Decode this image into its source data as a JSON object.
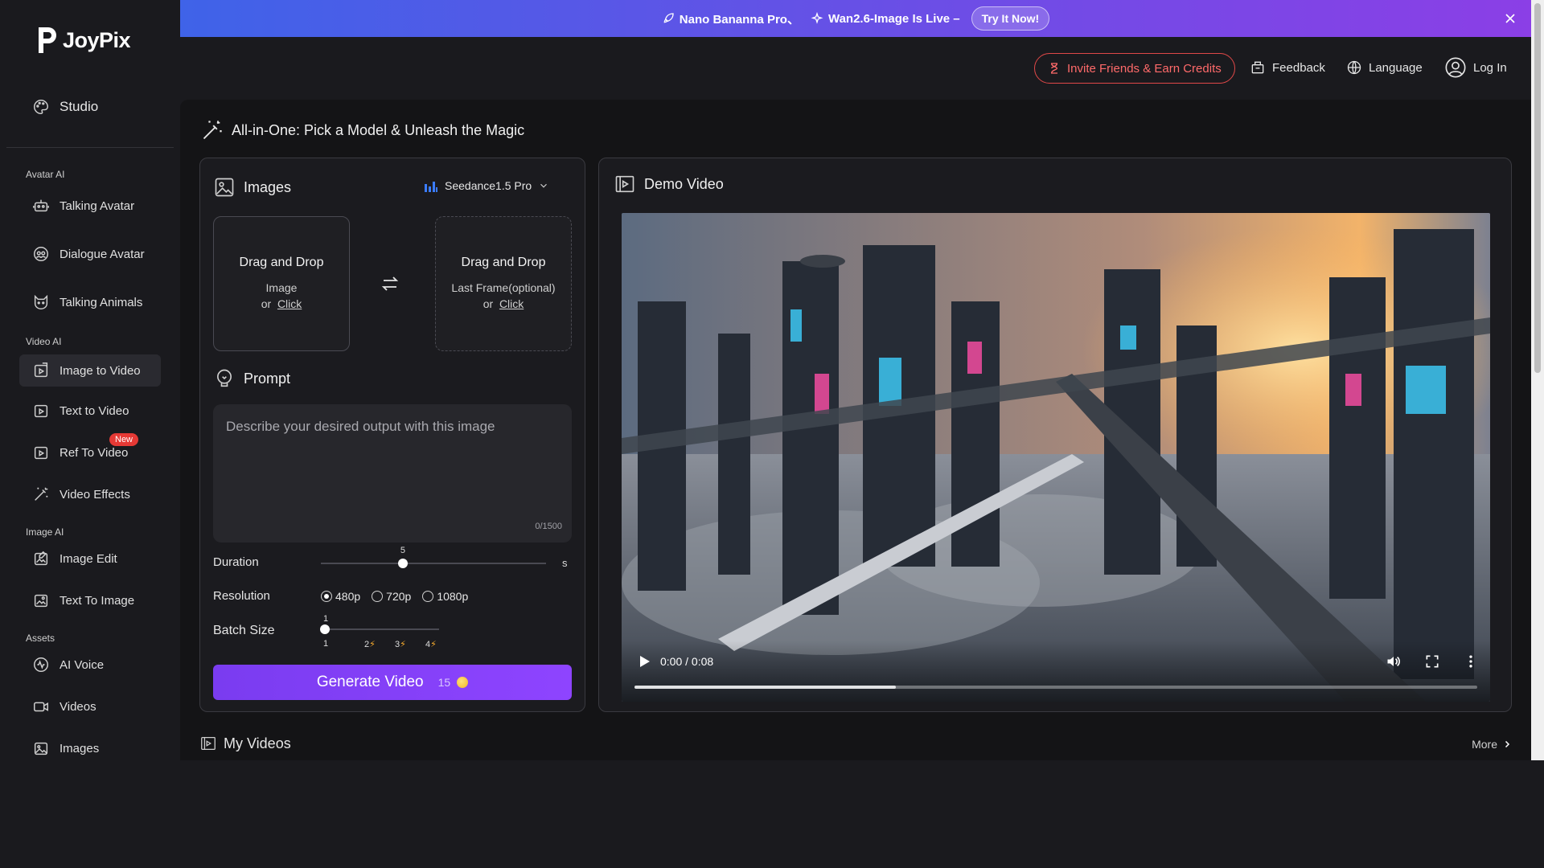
{
  "brand": {
    "name": "JoyPix"
  },
  "sidebar": {
    "studio": "Studio",
    "sections": {
      "avatar_ai": "Avatar AI",
      "video_ai": "Video AI",
      "image_ai": "Image AI",
      "assets": "Assets"
    },
    "items": {
      "talking_avatar": "Talking Avatar",
      "dialogue_avatar": "Dialogue Avatar",
      "talking_animals": "Talking Animals",
      "image_to_video": "Image to Video",
      "text_to_video": "Text to Video",
      "ref_to_video": "Ref To Video",
      "ref_badge": "New",
      "video_effects": "Video Effects",
      "image_edit": "Image Edit",
      "text_to_image": "Text To Image",
      "ai_voice": "AI Voice",
      "videos": "Videos",
      "images": "Images"
    },
    "active": "image_to_video"
  },
  "banner": {
    "item1": "Nano Bananna Pro、",
    "item2": "Wan2.6-Image Is Live –",
    "cta": "Try It Now!"
  },
  "topbar": {
    "invite": "Invite Friends & Earn Credits",
    "feedback": "Feedback",
    "language": "Language",
    "login": "Log In"
  },
  "main": {
    "title": "All-in-One: Pick a Model & Unleash the Magic",
    "images_label": "Images",
    "model": "Seedance1.5 Pro",
    "drop1": {
      "title": "Drag and Drop",
      "sub": "Image",
      "or": "or",
      "click": "Click"
    },
    "drop2": {
      "title": "Drag and Drop",
      "sub": "Last Frame(optional)",
      "or": "or",
      "click": "Click"
    },
    "prompt_label": "Prompt",
    "prompt_placeholder": "Describe your desired output with this image",
    "prompt_value": "",
    "counter": "0/1500",
    "duration": {
      "label": "Duration",
      "value": 5,
      "min": 1,
      "max": 12,
      "unit": "s",
      "value_text": "5"
    },
    "resolution": {
      "label": "Resolution",
      "options": [
        "480p",
        "720p",
        "1080p"
      ],
      "selected": "480p"
    },
    "batch": {
      "label": "Batch Size",
      "value_text": "1",
      "marks": [
        "1",
        "2",
        "3",
        "4"
      ]
    },
    "generate": {
      "label": "Generate Video",
      "credits": "15"
    },
    "demo_label": "Demo Video",
    "video": {
      "time": "0:00 / 0:08",
      "progress": 0.31
    },
    "my_videos": "My Videos",
    "more": "More"
  },
  "colors": {
    "accent": "#8b45ff",
    "invite": "#ff5a5a",
    "badge": "#e53935"
  }
}
